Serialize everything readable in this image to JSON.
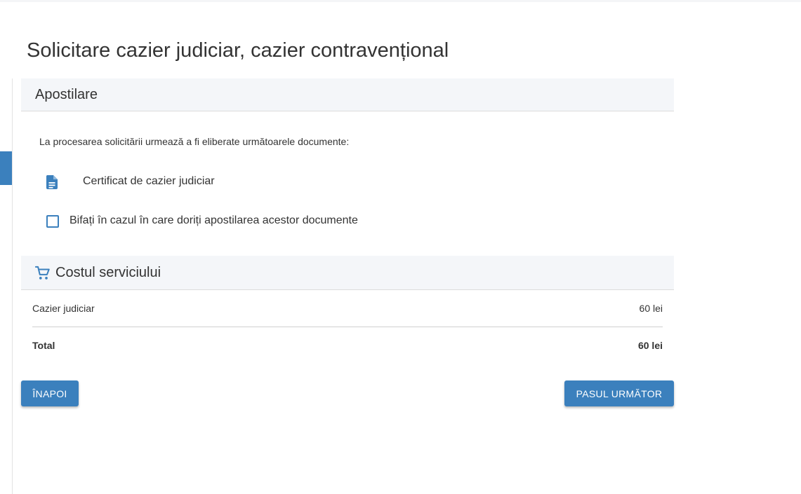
{
  "page": {
    "title": "Solicitare cazier judiciar, cazier contravențional"
  },
  "apostilare": {
    "header": "Apostilare",
    "intro": "La procesarea solicitării urmează a fi eliberate următoarele documente:",
    "document": {
      "icon": "document-icon",
      "label": "Certificat de cazier judiciar"
    },
    "checkbox": {
      "checked": false,
      "label": "Bifați în cazul în care doriți apostilarea acestor documente"
    }
  },
  "cost": {
    "icon": "cart-icon",
    "header": "Costul serviciului",
    "items": [
      {
        "name": "Cazier judiciar",
        "value": "60 lei"
      }
    ],
    "total": {
      "name": "Total",
      "value": "60 lei"
    }
  },
  "buttons": {
    "back": "ÎNAPOI",
    "next": "PASUL URMĂTOR"
  },
  "colors": {
    "accent": "#3b80bd",
    "header_bg": "#f4f6f9",
    "text": "#333333"
  }
}
